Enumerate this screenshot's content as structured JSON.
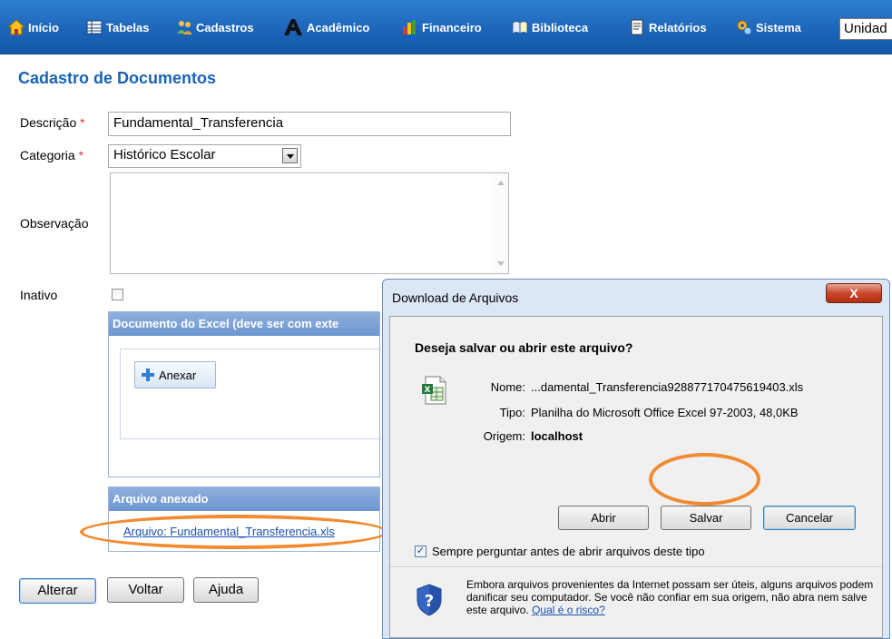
{
  "menu": {
    "items": [
      {
        "label": "Início",
        "icon": "home-icon"
      },
      {
        "label": "Tabelas",
        "icon": "table-icon"
      },
      {
        "label": "Cadastros",
        "icon": "users-icon"
      },
      {
        "label": "Acadêmico",
        "icon": "academic-icon"
      },
      {
        "label": "Financeiro",
        "icon": "finance-icon"
      },
      {
        "label": "Biblioteca",
        "icon": "library-icon"
      },
      {
        "label": "Relatórios",
        "icon": "report-icon"
      },
      {
        "label": "Sistema",
        "icon": "system-icon"
      }
    ],
    "unidade_value": "Unidad"
  },
  "page": {
    "title": "Cadastro de Documentos",
    "required_mark": "*",
    "fields": {
      "descricao_label": "Descrição",
      "descricao_value": "Fundamental_Transferencia",
      "categoria_label": "Categoria",
      "categoria_value": "Histórico Escolar",
      "observacao_label": "Observação",
      "inativo_label": "Inativo"
    },
    "excel_panel_header": "Documento do Excel (deve ser com exte",
    "anexar_label": "Anexar",
    "attached_panel_header": "Arquivo anexado",
    "attached_file_link": "Arquivo: Fundamental_Transferencia.xls",
    "buttons": {
      "alterar": "Alterar",
      "voltar": "Voltar",
      "ajuda": "Ajuda"
    }
  },
  "dialog": {
    "title": "Download de Arquivos",
    "close_label": "X",
    "question": "Deseja salvar ou abrir este arquivo?",
    "nome_label": "Nome:",
    "nome_value": "...damental_Transferencia928877170475619403.xls",
    "tipo_label": "Tipo:",
    "tipo_value": "Planilha do Microsoft Office Excel 97-2003, 48,0KB",
    "origem_label": "Origem:",
    "origem_value": "localhost",
    "buttons": {
      "abrir": "Abrir",
      "salvar": "Salvar",
      "cancelar": "Cancelar"
    },
    "always_ask_label": "Sempre perguntar antes de abrir arquivos deste tipo",
    "always_ask_checked": true,
    "warning_text": "Embora arquivos provenientes da Internet possam ser úteis, alguns arquivos podem danificar seu computador. Se você não confiar em sua origem, não abra nem salve este arquivo.",
    "risk_link": "Qual é o risco?"
  },
  "colors": {
    "menu_bar": "#1b63b8",
    "title_blue": "#1a63b5",
    "panel_header": "#7aa0d6",
    "highlight_ellipse": "#f28a30",
    "required": "#d23b2b"
  }
}
